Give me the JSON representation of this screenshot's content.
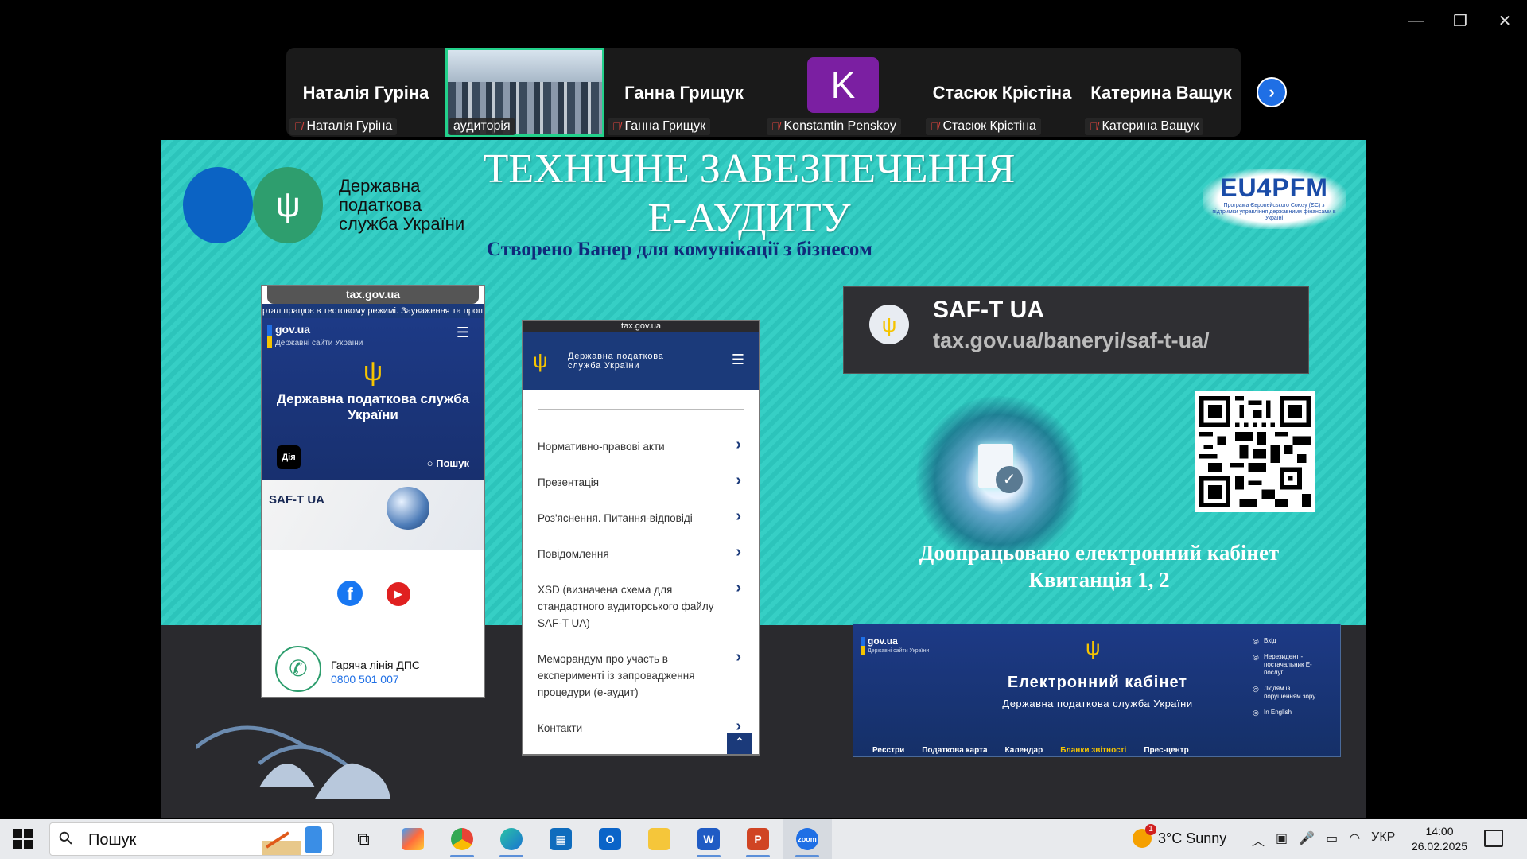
{
  "participants": [
    {
      "big_name": "Наталія Гуріна",
      "label": "Наталія Гуріна",
      "type": "name"
    },
    {
      "big_name": "",
      "label": "аудиторія",
      "type": "video"
    },
    {
      "big_name": "Ганна Грищук",
      "label": "Ганна Грищук",
      "type": "name"
    },
    {
      "big_name": "",
      "label": "Konstantin Penskoy",
      "type": "avatar",
      "avatar_letter": "K",
      "avatar_color": "#7b1fa2"
    },
    {
      "big_name": "Стасюк Крістіна",
      "label": "Стасюк Крістіна",
      "type": "name"
    },
    {
      "big_name": "Катерина Ващук",
      "label": "Катерина Ващук",
      "type": "name"
    }
  ],
  "slide": {
    "logo_text": [
      "Державна",
      "податкова",
      "служба України"
    ],
    "title_line1": "ТЕХНІЧНЕ ЗАБЕЗПЕЧЕННЯ",
    "title_line2": "Е-АУДИТУ",
    "subtitle": "Створено Банер для комунікації з бізнесом",
    "eu_logo": "EU4PFM",
    "eu_caption": "Програма Європейського Союзу (ЄС) з підтримки управління державними фінансами в Україні",
    "phone1": {
      "url": "tax.gov.ua",
      "ticker": "ртал працює в тестовому режимі. Зауваження та проп",
      "gov": "gov.ua",
      "gov_sub": "Державні сайти України",
      "agency": "Державна податкова служба України",
      "diia": "Дія",
      "search": "Пошук",
      "banner": "SAF-T UA",
      "hotline_label": "Гаряча лінія ДПС",
      "hotline_number": "0800 501 007"
    },
    "phone2": {
      "url": "tax.gov.ua",
      "agency_line1": "Державна податкова",
      "agency_line2": "служба України",
      "menu": [
        "Нормативно-правові акти",
        "Презентація",
        "Роз'яснення. Питання-відповіді",
        "Повідомлення",
        "XSD (визначена схема для стандартного аудиторського файлу SAF-T UA)",
        "Меморандум про участь в експерименті із запровадження процедури (е-аудит)",
        "Контакти"
      ]
    },
    "saft_box": {
      "title": "SAF-T UA",
      "url": "tax.gov.ua/baneryi/saf-t-ua/"
    },
    "note_line1": "Доопрацьовано електронний кабінет",
    "note_line2": "Квитанція 1, 2",
    "cabinet": {
      "gov": "gov.ua",
      "gov_sub": "Державні сайти України",
      "title": "Електронний кабінет",
      "subtitle": "Державна податкова служба України",
      "side": [
        "Вхід",
        "Нерезидент - постачальник Е-послуг",
        "Людям із порушенням зору",
        "In English"
      ],
      "nav": [
        "Реєстри",
        "Податкова карта",
        "Календар",
        "Бланки звітності",
        "Прес-центр"
      ]
    }
  },
  "taskbar": {
    "search_placeholder": "Пошук",
    "weather": "3°C  Sunny",
    "weather_badge": "1",
    "lang": "УКР",
    "time": "14:00",
    "date": "26.02.2025"
  },
  "colors": {
    "slide_bg": "#2cc4bb",
    "accent_blue": "#1b3a7a",
    "active_speaker": "#23d18b"
  }
}
